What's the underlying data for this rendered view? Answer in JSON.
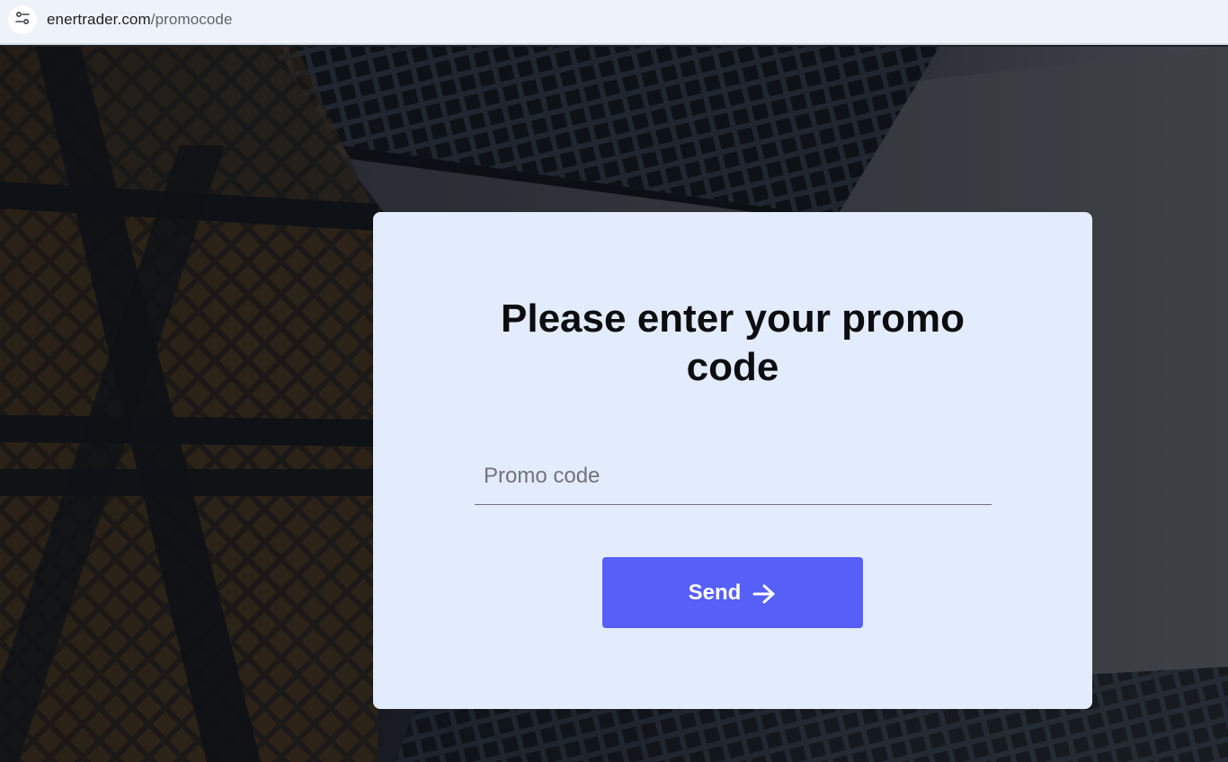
{
  "browser": {
    "url_domain": "enertrader.com",
    "url_path": "/promocode",
    "site_info_icon": "tune-icon"
  },
  "card": {
    "title": "Please enter your promo code",
    "promo_input": {
      "placeholder": "Promo code",
      "value": ""
    },
    "send_button": {
      "label": "Send",
      "icon": "arrow-right-icon"
    }
  },
  "colors": {
    "card_background": "#e3ecfc",
    "button_background": "#565ff8",
    "button_text": "#ffffff",
    "title_text": "#0c0d10"
  }
}
